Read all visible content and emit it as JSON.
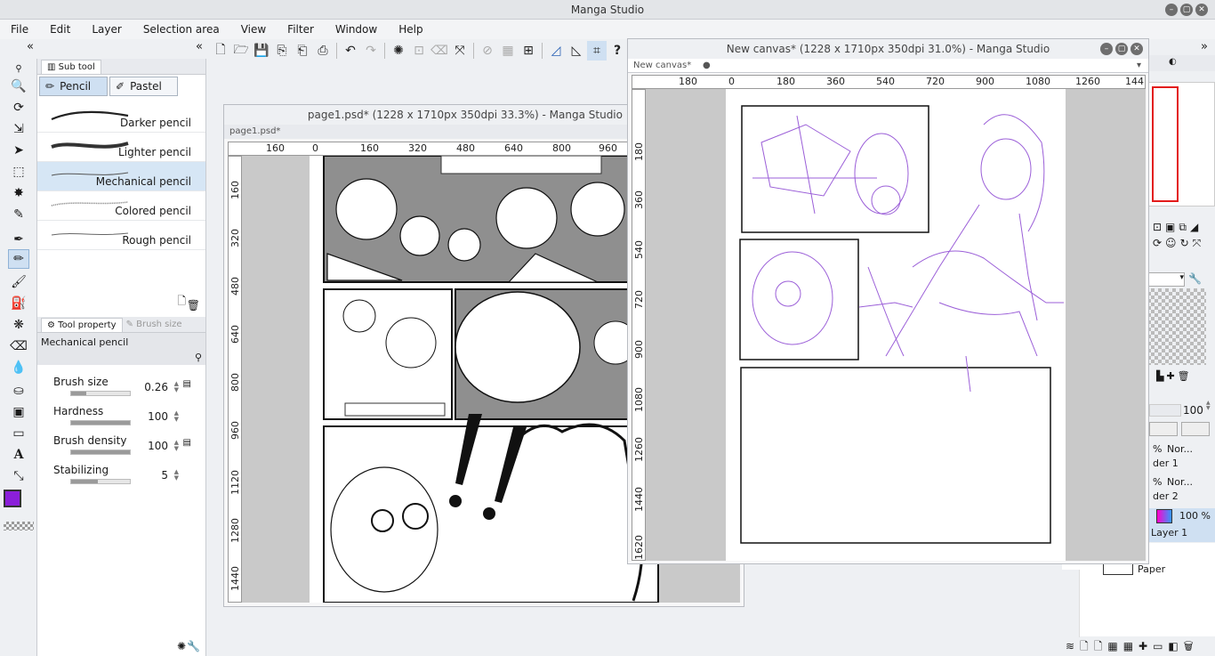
{
  "app": {
    "title": "Manga Studio"
  },
  "menu": [
    "File",
    "Edit",
    "Layer",
    "Selection area",
    "View",
    "Filter",
    "Window",
    "Help"
  ],
  "subtool": {
    "header": "Sub tool",
    "tabs": [
      {
        "label": "Pencil",
        "active": true
      },
      {
        "label": "Pastel",
        "active": false
      }
    ],
    "brushes": [
      {
        "name": "Darker pencil",
        "active": false
      },
      {
        "name": "Lighter pencil",
        "active": false
      },
      {
        "name": "Mechanical pencil",
        "active": true
      },
      {
        "name": "Colored pencil",
        "active": false
      },
      {
        "name": "Rough pencil",
        "active": false
      }
    ]
  },
  "tool_property": {
    "header": "Tool property",
    "header2": "Brush size",
    "name": "Mechanical pencil",
    "rows": [
      {
        "label": "Brush size",
        "value": "0.26",
        "level": 0.25
      },
      {
        "label": "Hardness",
        "value": "100",
        "level": 1.0
      },
      {
        "label": "Brush density",
        "value": "100",
        "level": 1.0
      },
      {
        "label": "Stabilizing",
        "value": "5",
        "level": 0.45
      }
    ]
  },
  "doc1": {
    "title": "page1.psd* (1228 x 1710px 350dpi 33.3%)  - Manga Studio",
    "tab": "page1.psd*",
    "ruler_h": [
      "160",
      "0",
      "160",
      "320",
      "480",
      "640",
      "800",
      "960"
    ],
    "ruler_v": [
      "160",
      "320",
      "480",
      "640",
      "800",
      "960",
      "1120",
      "1280",
      "1440"
    ]
  },
  "doc2": {
    "title": "New canvas* (1228 x 1710px 350dpi 31.0%)  - Manga Studio",
    "tab": "New canvas*",
    "ruler_h": [
      "180",
      "0",
      "180",
      "360",
      "540",
      "720",
      "900",
      "1080",
      "1260",
      "144"
    ],
    "ruler_v": [
      "180",
      "360",
      "540",
      "720",
      "900",
      "1080",
      "1260",
      "1440",
      "1620"
    ]
  },
  "layers": {
    "opacity": "100",
    "items": [
      {
        "pct": "%",
        "mode": "Nor...",
        "name": "der 1"
      },
      {
        "pct": "%",
        "mode": "Nor...",
        "name": "der 2"
      },
      {
        "pct": "100 %",
        "mode": "",
        "name": "Layer 1"
      },
      {
        "pct": "",
        "mode": "",
        "name": "Paper"
      }
    ]
  },
  "colors": {
    "main": "#8b1fd9",
    "sketch": "#9b5fd8",
    "accent": "#cfe0f2"
  }
}
